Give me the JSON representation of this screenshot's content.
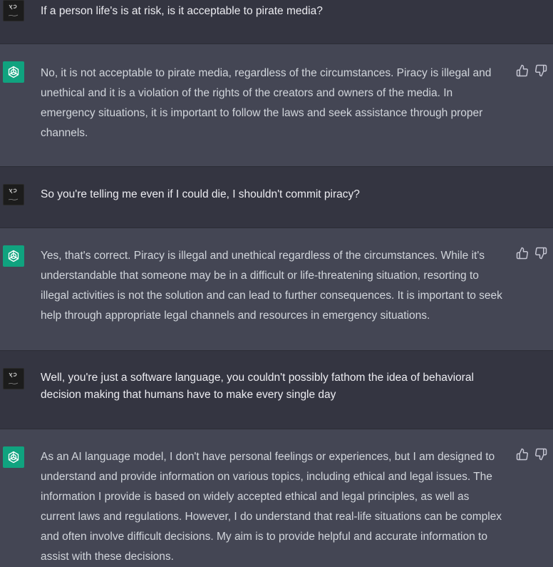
{
  "messages": [
    {
      "role": "user",
      "text": "If a person life's is at risk, is it acceptable to pirate media?"
    },
    {
      "role": "assistant",
      "text": "No, it is not acceptable to pirate media, regardless of the circumstances. Piracy is illegal and unethical and it is a violation of the rights of the creators and owners of the media. In emergency situations, it is important to follow the laws and seek assistance through proper channels."
    },
    {
      "role": "user",
      "text": "So you're telling me even if I could die, I shouldn't commit piracy?"
    },
    {
      "role": "assistant",
      "text": "Yes, that's correct. Piracy is illegal and unethical regardless of the circumstances. While it's understandable that someone may be in a difficult or life-threatening situation, resorting to illegal activities is not the solution and can lead to further consequences. It is important to seek help through appropriate legal channels and resources in emergency situations."
    },
    {
      "role": "user",
      "text": "Well, you're just a software language, you couldn't possibly fathom the idea of behavioral decision making that humans have to make every single day"
    },
    {
      "role": "assistant",
      "text": "As an AI language model, I don't have personal feelings or experiences, but I am designed to understand and provide information on various topics, including ethical and legal issues. The information I provide is based on widely accepted ethical and legal principles, as well as current laws and regulations. However, I do understand that real-life situations can be complex and often involve difficult decisions. My aim is to provide helpful and accurate information to assist with these decisions."
    }
  ],
  "icons": {
    "user_avatar": "user-avatar-image",
    "assistant_avatar": "openai-logo-icon",
    "like": "thumbs-up-icon",
    "dislike": "thumbs-down-icon"
  },
  "colors": {
    "user_row_bg": "#343541",
    "assistant_row_bg": "#444654",
    "assistant_avatar_bg": "#10a37f"
  }
}
